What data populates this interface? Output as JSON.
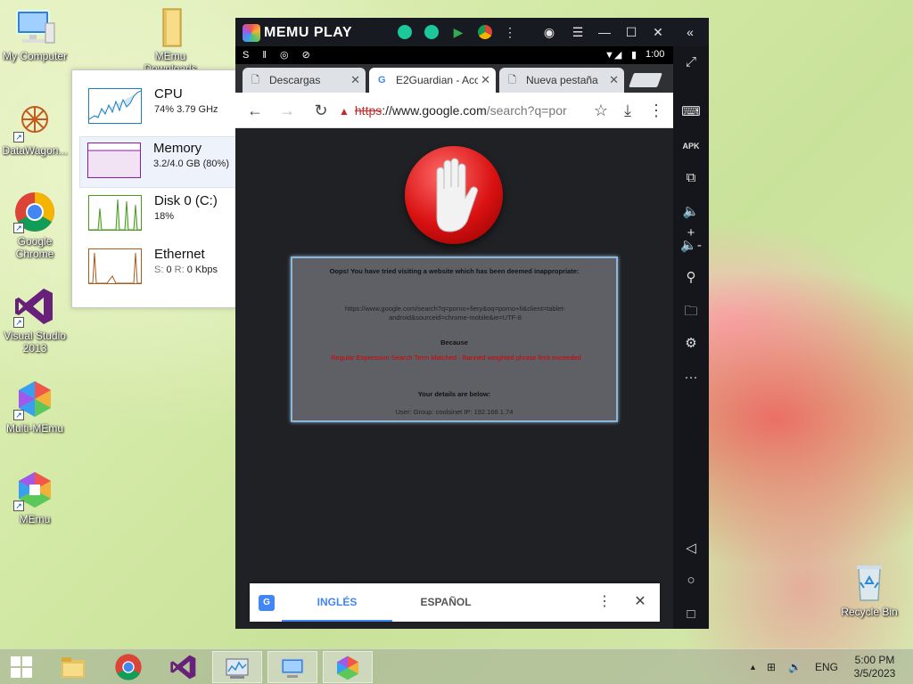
{
  "desktop": {
    "icons": [
      {
        "label": "My Computer"
      },
      {
        "label": "MEmu Downloads"
      },
      {
        "label": "DataWagon..."
      },
      {
        "label": "Google Chrome"
      },
      {
        "label": "Visual Studio 2013"
      },
      {
        "label": "Multi-MEmu"
      },
      {
        "label": "MEmu"
      },
      {
        "label": "Recycle Bin"
      }
    ]
  },
  "taskmgr": {
    "rows": [
      {
        "name": "CPU",
        "value": "74% 3.79 GHz",
        "color": "#1a7fbf"
      },
      {
        "name": "Memory",
        "value": "3.2/4.0 GB (80%)",
        "color": "#8b1aa8"
      },
      {
        "name": "Disk 0 (C:)",
        "value": "18%",
        "color": "#4a9a1e"
      },
      {
        "name": "Ethernet",
        "value_s_label": "S:",
        "value_s": "0",
        "value_r_label": "R:",
        "value_r": "0 Kbps",
        "color": "#a85a1a"
      }
    ]
  },
  "memu": {
    "title": "MEMU PLAY",
    "status_time": "1:00",
    "tabs": [
      {
        "label": "Descargas",
        "icon": "page-icon"
      },
      {
        "label": "E2Guardian - Acc",
        "icon": "google-icon"
      },
      {
        "label": "Nueva pestaña",
        "icon": "page-icon"
      }
    ],
    "url": {
      "scheme": "https",
      "rest": "://www.google.com",
      "path": "/search?q=por"
    },
    "block": {
      "heading": "Oops! You have tried visiting a website which has been deemed inappropriate:",
      "url_text": "https://www.google.com/search?q=porno+fiery&oq=porno+fi&client=tablet-android&sourceid=chrome-mobile&ie=UTF-8",
      "because": "Because",
      "reason": "Regular Expression Search Term Matched - Banned weighted phrase limit exceeded",
      "details": "Your details are below:",
      "user_line": "User:    Group: coolsinet    IP: 192.168.1.74"
    },
    "translate": {
      "lang_active": "INGLÉS",
      "lang_other": "ESPAÑOL"
    }
  },
  "taskbar": {
    "tray_lang": "ENG",
    "time": "5:00 PM",
    "date": "3/5/2023"
  }
}
